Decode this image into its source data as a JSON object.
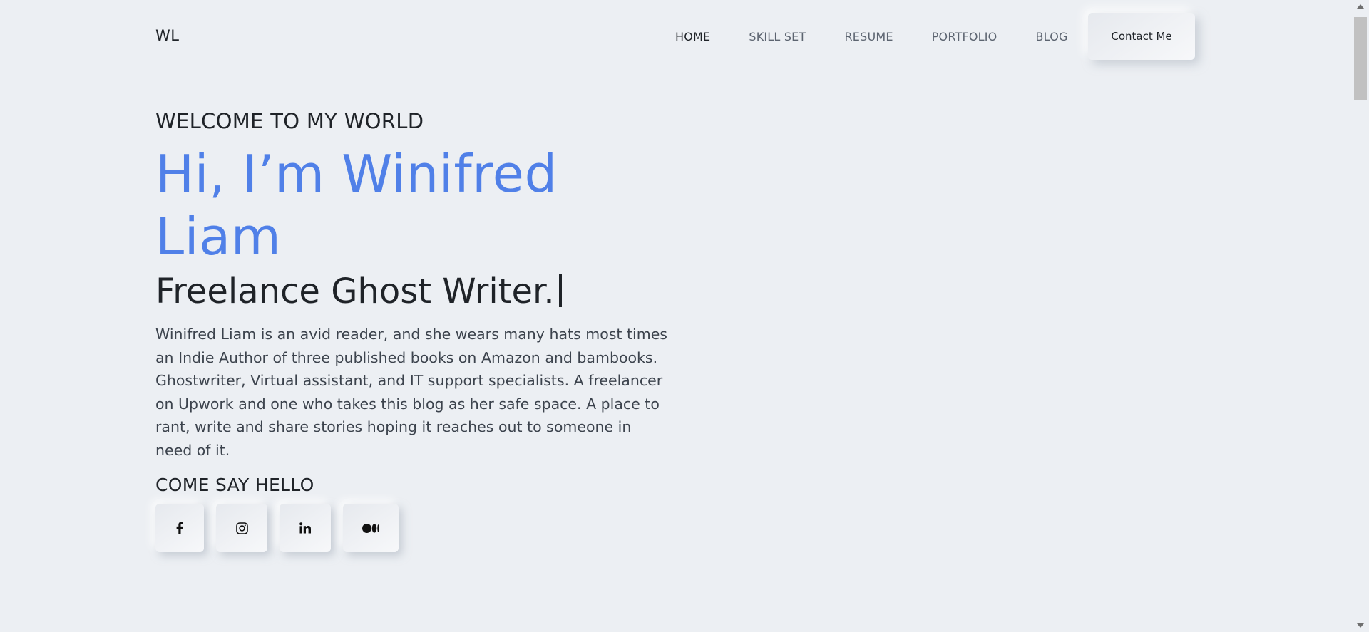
{
  "header": {
    "logo": "WL",
    "nav": [
      {
        "label": "HOME",
        "active": true
      },
      {
        "label": "SKILL SET",
        "active": false
      },
      {
        "label": "RESUME",
        "active": false
      },
      {
        "label": "PORTFOLIO",
        "active": false
      },
      {
        "label": "BLOG",
        "active": false
      }
    ],
    "contact_label": "Contact Me"
  },
  "hero": {
    "welcome": "WELCOME TO MY WORLD",
    "name": "Hi, I’m Winifred Liam",
    "role": "Freelance Ghost Writer.",
    "bio": "Winifred Liam is an avid reader, and she wears many hats most times an Indie Author of three published books on Amazon and bambooks. Ghostwriter, Virtual assistant, and IT support specialists. A freelancer on Upwork and one who takes this blog as her safe space. A place to rant, write and share stories hoping it reaches out to someone in need of it.",
    "say_hello": "COME SAY HELLO"
  },
  "socials": [
    {
      "icon": "facebook-icon"
    },
    {
      "icon": "instagram-icon"
    },
    {
      "icon": "linkedin-icon"
    },
    {
      "icon": "medium-icon"
    }
  ],
  "colors": {
    "background": "#eceff3",
    "accent": "#5080e8",
    "text": "#1f2328"
  }
}
